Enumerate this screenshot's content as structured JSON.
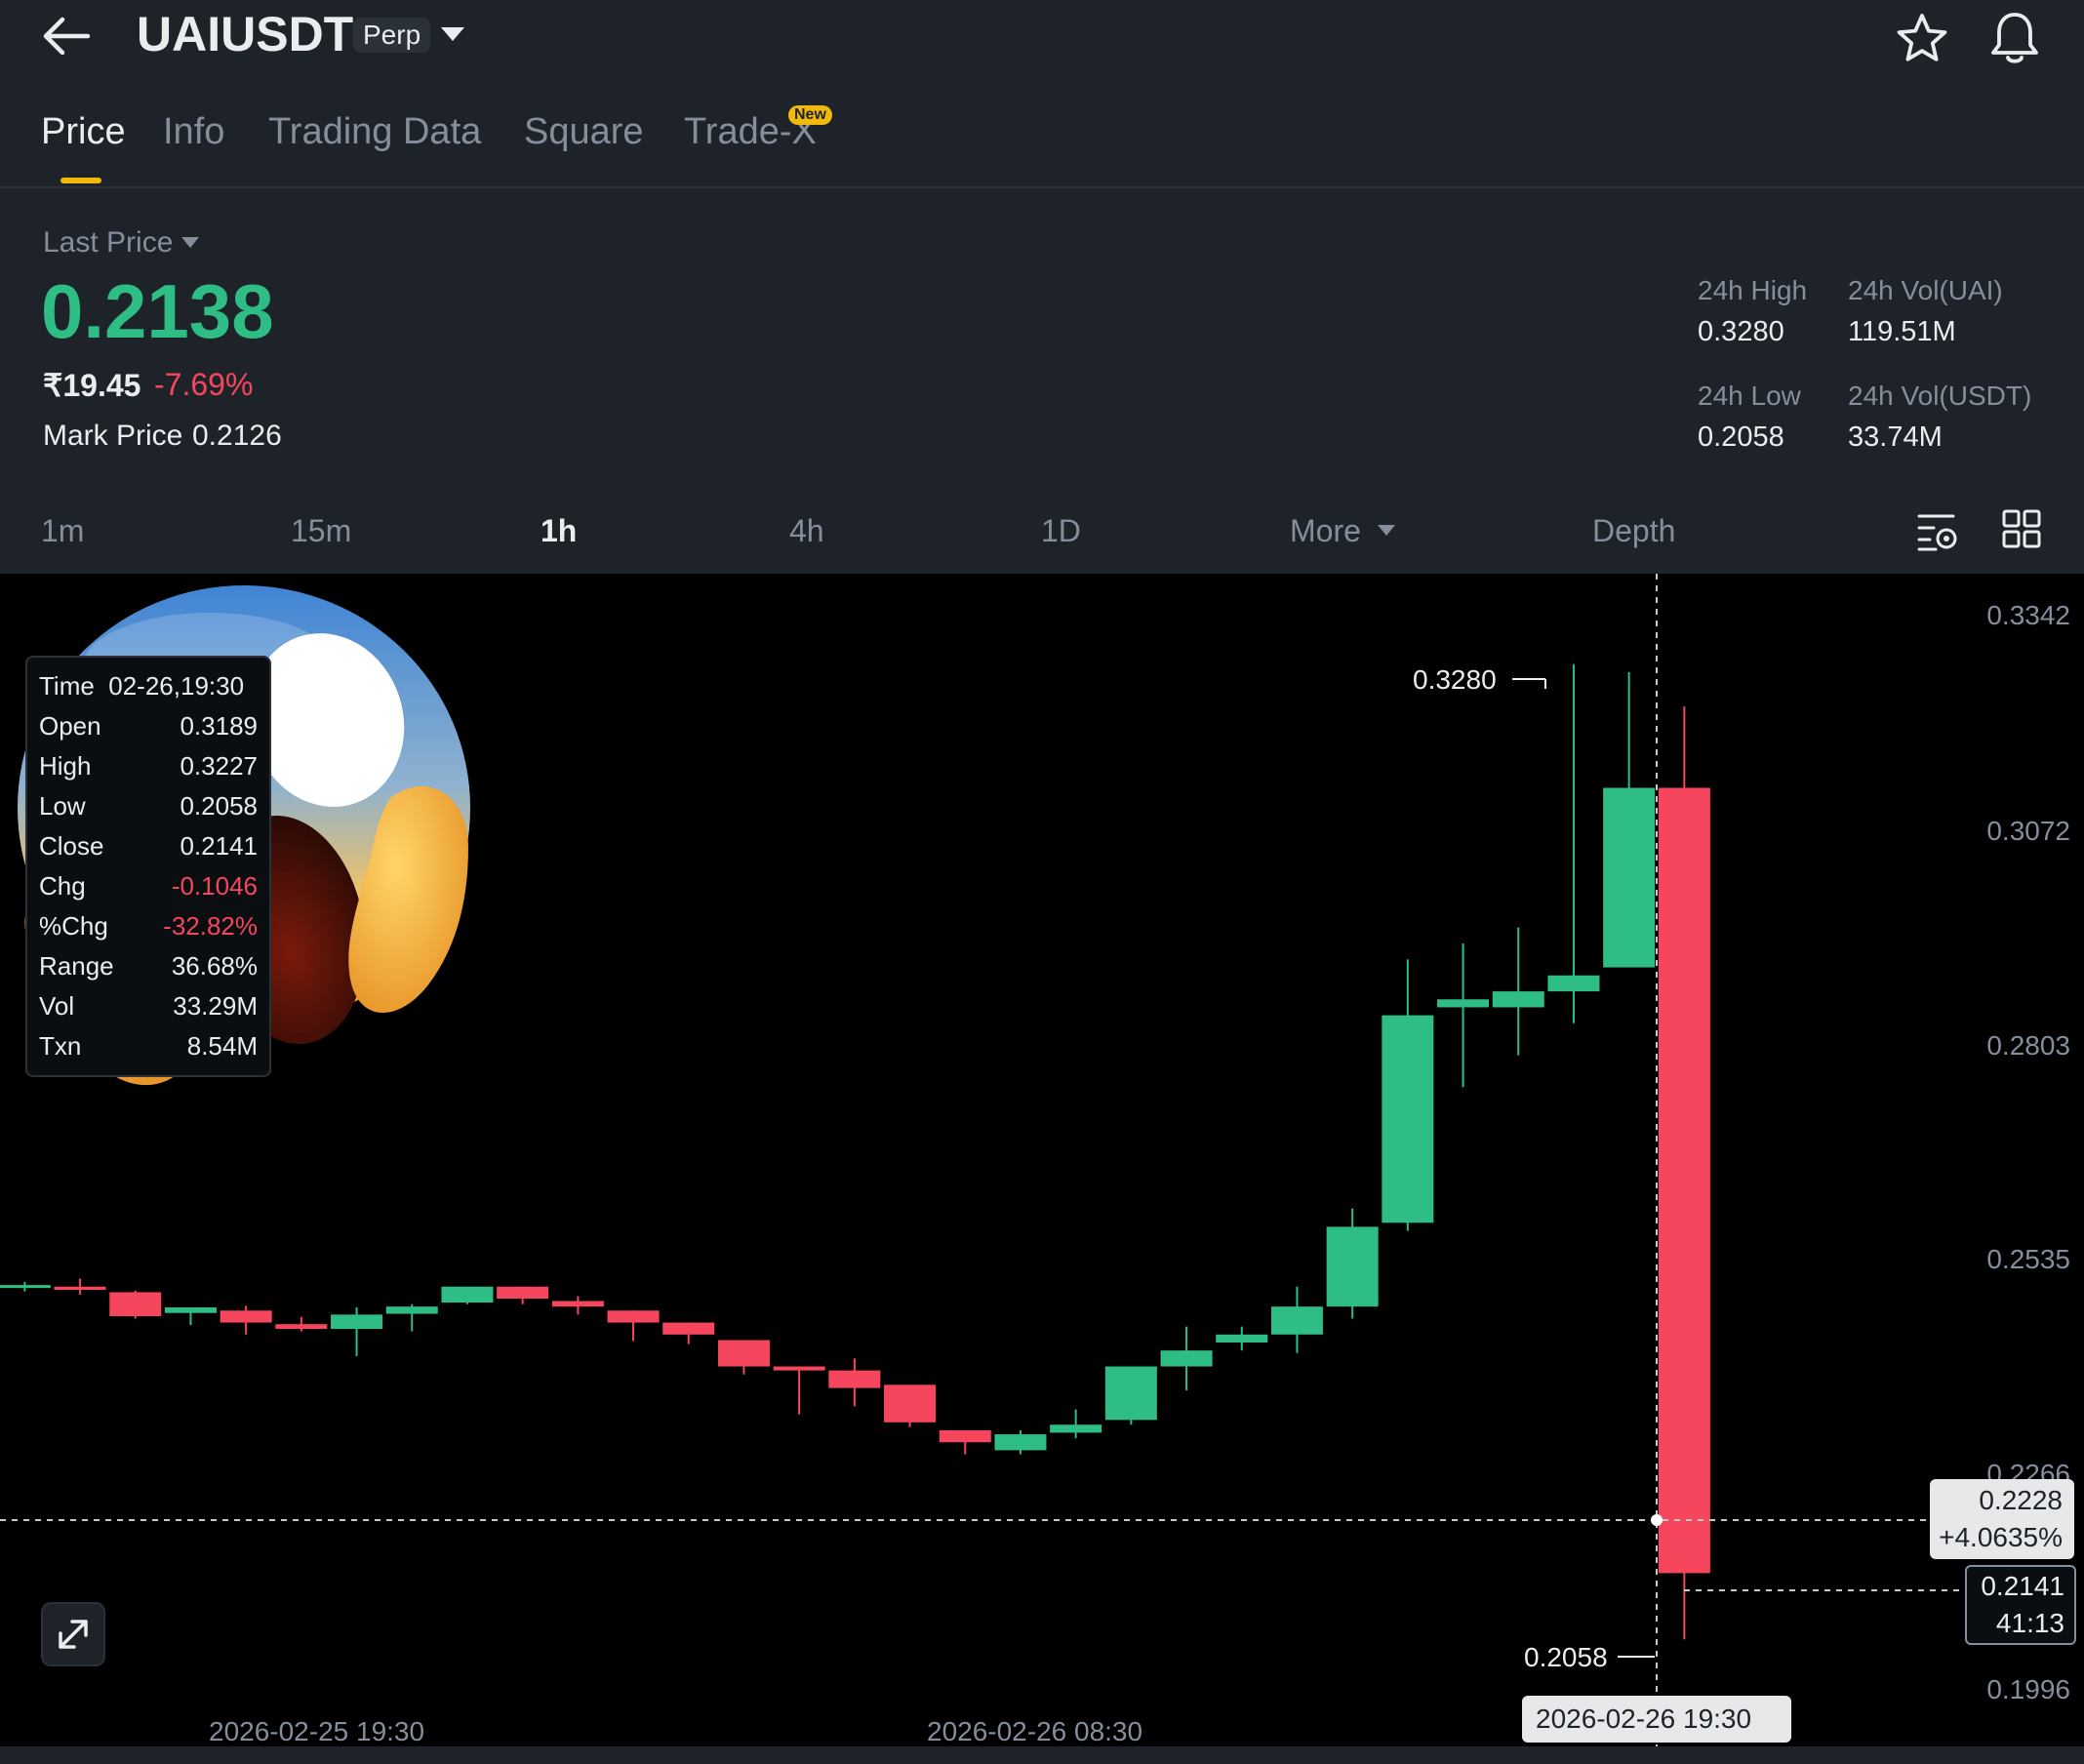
{
  "header": {
    "back_icon": "arrow-left-icon",
    "symbol": "UAIUSDT",
    "contract_type": "Perp",
    "dropdown_icon": "caret-down-icon",
    "favorite_icon": "star-icon",
    "alert_icon": "bell-icon"
  },
  "tabs": [
    {
      "label": "Price",
      "active": true
    },
    {
      "label": "Info"
    },
    {
      "label": "Trading Data"
    },
    {
      "label": "Square"
    },
    {
      "label": "Trade-X",
      "badge": "New"
    }
  ],
  "price": {
    "label": "Last Price",
    "last": "0.2138",
    "fiat": "₹19.45",
    "change": "-7.69%",
    "mark_label": "Mark Price",
    "mark_value": "0.2126",
    "colors": {
      "up": "#2ebd85",
      "down": "#f6465d",
      "accent": "#f0b90b"
    }
  },
  "stats": {
    "high_label": "24h High",
    "high": "0.3280",
    "vol_base_label": "24h Vol(UAI)",
    "vol_base": "119.51M",
    "low_label": "24h Low",
    "low": "0.2058",
    "vol_quote_label": "24h Vol(USDT)",
    "vol_quote": "33.74M"
  },
  "intervals": [
    {
      "label": "1m"
    },
    {
      "label": "15m"
    },
    {
      "label": "1h",
      "active": true
    },
    {
      "label": "4h"
    },
    {
      "label": "1D"
    },
    {
      "label": "More"
    },
    {
      "label": "Depth"
    }
  ],
  "toolbar_icons": [
    "chart-settings-icon",
    "grid-layout-icon"
  ],
  "ohlc": {
    "time_label": "Time",
    "time": "02-26,19:30",
    "rows": [
      {
        "k": "Open",
        "v": "0.3189"
      },
      {
        "k": "High",
        "v": "0.3227"
      },
      {
        "k": "Low",
        "v": "0.2058"
      },
      {
        "k": "Close",
        "v": "0.2141"
      },
      {
        "k": "Chg",
        "v": "-0.1046",
        "neg": true
      },
      {
        "k": "%Chg",
        "v": "-32.82%",
        "neg": true
      },
      {
        "k": "Range",
        "v": "36.68%"
      },
      {
        "k": "Vol",
        "v": "33.29M"
      },
      {
        "k": "Txn",
        "v": "8.54M"
      }
    ]
  },
  "chart_data": {
    "type": "candlestick",
    "y_ticks": [
      "0.3342",
      "0.3072",
      "0.2803",
      "0.2535",
      "0.2266",
      "0.1996"
    ],
    "ylim": [
      0.1996,
      0.3342
    ],
    "x_labels": [
      "2026-02-25 19:30",
      "2026-02-26 08:30"
    ],
    "high_marker": "0.3280",
    "low_marker": "0.2058",
    "crosshair_price": "0.2228",
    "crosshair_pct": "+4.0635%",
    "current_price": "0.2141",
    "countdown": "41:13",
    "crosshair_time": "2026-02-26 19:30",
    "candles": [
      {
        "o": 0.25,
        "h": 0.2506,
        "l": 0.2494,
        "c": 0.2502
      },
      {
        "o": 0.25,
        "h": 0.251,
        "l": 0.249,
        "c": 0.2496
      },
      {
        "o": 0.2493,
        "h": 0.2495,
        "l": 0.246,
        "c": 0.2463
      },
      {
        "o": 0.2467,
        "h": 0.2474,
        "l": 0.2452,
        "c": 0.2474
      },
      {
        "o": 0.247,
        "h": 0.2476,
        "l": 0.244,
        "c": 0.2455
      },
      {
        "o": 0.2453,
        "h": 0.2462,
        "l": 0.2444,
        "c": 0.2447
      },
      {
        "o": 0.2447,
        "h": 0.2474,
        "l": 0.2413,
        "c": 0.2465
      },
      {
        "o": 0.2466,
        "h": 0.2478,
        "l": 0.2444,
        "c": 0.2475
      },
      {
        "o": 0.248,
        "h": 0.25,
        "l": 0.2478,
        "c": 0.25
      },
      {
        "o": 0.25,
        "h": 0.25,
        "l": 0.2478,
        "c": 0.2485
      },
      {
        "o": 0.2482,
        "h": 0.2488,
        "l": 0.2465,
        "c": 0.2475
      },
      {
        "o": 0.247,
        "h": 0.247,
        "l": 0.2432,
        "c": 0.2455
      },
      {
        "o": 0.2455,
        "h": 0.2455,
        "l": 0.2428,
        "c": 0.244
      },
      {
        "o": 0.2433,
        "h": 0.2433,
        "l": 0.239,
        "c": 0.24
      },
      {
        "o": 0.24,
        "h": 0.24,
        "l": 0.234,
        "c": 0.2395
      },
      {
        "o": 0.2395,
        "h": 0.241,
        "l": 0.235,
        "c": 0.2373
      },
      {
        "o": 0.2377,
        "h": 0.2377,
        "l": 0.2324,
        "c": 0.233
      },
      {
        "o": 0.232,
        "h": 0.232,
        "l": 0.229,
        "c": 0.2305
      },
      {
        "o": 0.2295,
        "h": 0.232,
        "l": 0.229,
        "c": 0.2315
      },
      {
        "o": 0.2317,
        "h": 0.2346,
        "l": 0.231,
        "c": 0.2327
      },
      {
        "o": 0.2333,
        "h": 0.24,
        "l": 0.2327,
        "c": 0.24
      },
      {
        "o": 0.24,
        "h": 0.245,
        "l": 0.237,
        "c": 0.242
      },
      {
        "o": 0.243,
        "h": 0.245,
        "l": 0.242,
        "c": 0.244
      },
      {
        "o": 0.244,
        "h": 0.25,
        "l": 0.2417,
        "c": 0.2475
      },
      {
        "o": 0.2475,
        "h": 0.2598,
        "l": 0.246,
        "c": 0.2575
      },
      {
        "o": 0.258,
        "h": 0.291,
        "l": 0.257,
        "c": 0.284
      },
      {
        "o": 0.285,
        "h": 0.293,
        "l": 0.275,
        "c": 0.286
      },
      {
        "o": 0.285,
        "h": 0.295,
        "l": 0.279,
        "c": 0.287
      },
      {
        "o": 0.287,
        "h": 0.328,
        "l": 0.283,
        "c": 0.289
      },
      {
        "o": 0.29,
        "h": 0.327,
        "l": 0.296,
        "c": 0.3125
      },
      {
        "o": 0.3125,
        "h": 0.3227,
        "l": 0.2058,
        "c": 0.2141
      }
    ]
  }
}
